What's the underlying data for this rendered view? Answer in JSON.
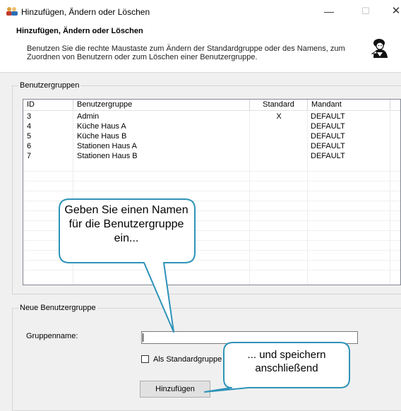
{
  "window": {
    "title": "Hinzufügen, Ändern oder Löschen",
    "minimize_symbol": "—",
    "maximize_symbol": "☐",
    "close_symbol": "✕"
  },
  "header": {
    "title": "Hinzufügen, Ändern oder Löschen",
    "description": "Benutzen Sie die rechte Maustaste zum Ändern der Standardgruppe oder des Namens, zum Zuordnen von Benutzern oder zum Löschen einer Benutzergruppe.",
    "icon": "wizard-person-icon"
  },
  "groups": {
    "list_title": "Benutzergruppen",
    "new_title": "Neue Benutzergruppe"
  },
  "table": {
    "columns": [
      "ID",
      "Benutzergruppe",
      "Standard",
      "Mandant"
    ],
    "rows": [
      {
        "id": "3",
        "name": "Admin",
        "standard": "X",
        "mandant": "DEFAULT"
      },
      {
        "id": "4",
        "name": "Küche Haus A",
        "standard": "",
        "mandant": "DEFAULT"
      },
      {
        "id": "5",
        "name": "Küche Haus B",
        "standard": "",
        "mandant": "DEFAULT"
      },
      {
        "id": "6",
        "name": "Stationen Haus A",
        "standard": "",
        "mandant": "DEFAULT"
      },
      {
        "id": "7",
        "name": "Stationen Haus B",
        "standard": "",
        "mandant": "DEFAULT"
      }
    ]
  },
  "form": {
    "name_label": "Gruppenname:",
    "name_value": "",
    "checkbox_label": "Als Standardgruppe",
    "checkbox_checked": false,
    "add_button": "Hinzufügen"
  },
  "callouts": {
    "first": "Geben Sie einen Namen für die Benutzergruppe ein...",
    "second": "... und speichern anschließend",
    "border_color": "#2e93b8"
  }
}
